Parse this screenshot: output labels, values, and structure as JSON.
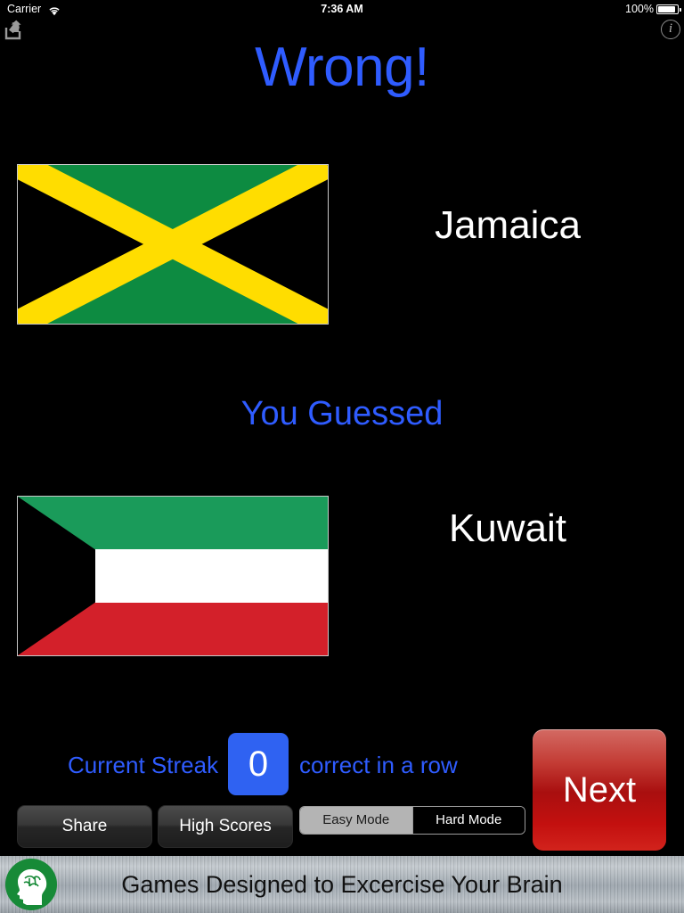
{
  "status_bar": {
    "carrier": "Carrier",
    "time": "7:36 AM",
    "battery_percent": "100%",
    "wifi_icon": "wifi-icon",
    "battery_icon": "battery-icon"
  },
  "nav": {
    "share_icon": "share-icon",
    "info_icon": "info-icon",
    "info_glyph": "i"
  },
  "result": {
    "title": "Wrong!",
    "title_color": "#2f5cff",
    "correct_answer": "Jamaica",
    "guessed_caption": "You Guessed",
    "guessed_answer": "Kuwait"
  },
  "flags": {
    "answer_flag_name": "jamaica-flag",
    "guess_flag_name": "kuwait-flag",
    "jamaica_colors": {
      "green": "#0d8b41",
      "yellow": "#ffdd00",
      "black": "#000000"
    },
    "kuwait_colors": {
      "green": "#1a9b5a",
      "white": "#ffffff",
      "red": "#d3202a",
      "black": "#000000"
    }
  },
  "streak": {
    "label_left": "Current Streak",
    "value": "0",
    "label_right": "correct in a row",
    "badge_color": "#2f62f2",
    "text_color": "#2f5cff"
  },
  "buttons": {
    "share": "Share",
    "high_scores": "High Scores",
    "next": "Next",
    "next_color": "#c3100f"
  },
  "mode_selector": {
    "options": [
      "Easy Mode",
      "Hard Mode"
    ],
    "selected": "Easy Mode"
  },
  "ad_banner": {
    "text": "Games Designed to Excercise Your Brain",
    "logo_icon": "brain-head-icon",
    "logo_color": "#178a37"
  }
}
